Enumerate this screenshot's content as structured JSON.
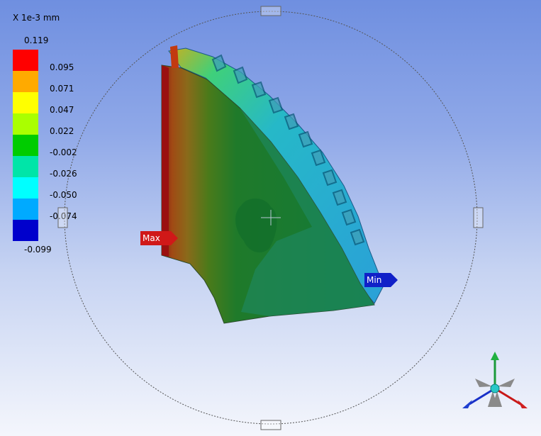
{
  "legend": {
    "unit_label": "X 1e-3 mm",
    "max_value": "0.119",
    "min_value": "-0.099",
    "bands": [
      {
        "label": "0.095",
        "color": "#ff0000"
      },
      {
        "label": "0.071",
        "color": "#ffaa00"
      },
      {
        "label": "0.047",
        "color": "#ffff00"
      },
      {
        "label": "0.022",
        "color": "#aaff00"
      },
      {
        "label": "-0.002",
        "color": "#00cc00"
      },
      {
        "label": "-0.026",
        "color": "#00e5a8"
      },
      {
        "label": "-0.050",
        "color": "#00ffff"
      },
      {
        "label": "-0.074",
        "color": "#00aaff"
      },
      {
        "label": "",
        "color": "#0000cc"
      }
    ]
  },
  "probes": {
    "max_label": "Max",
    "min_label": "Min"
  },
  "colors": {
    "max_probe": "#d01818",
    "min_probe": "#1020c8"
  },
  "triad": {
    "x_axis": "red",
    "y_axis": "green",
    "z_axis": "blue"
  }
}
